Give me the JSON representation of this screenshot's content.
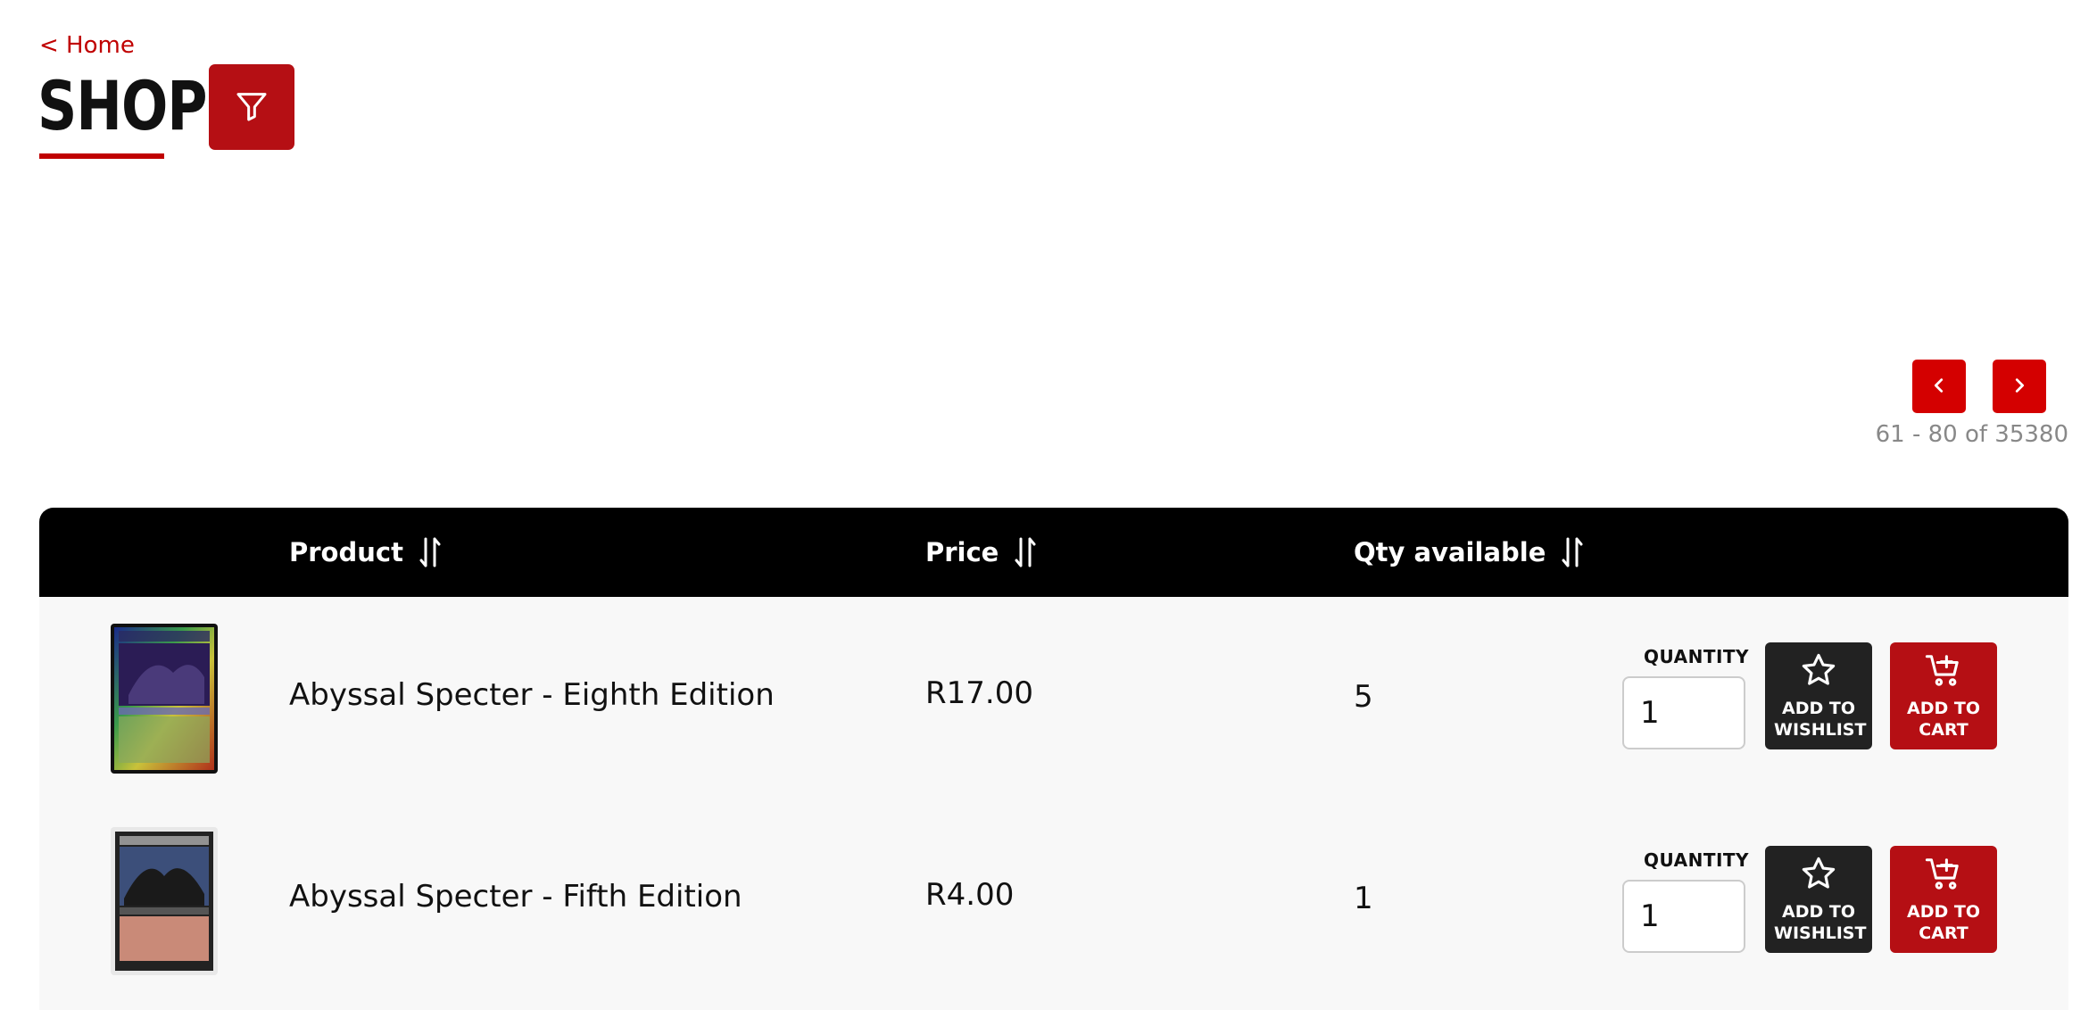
{
  "nav": {
    "home_label": "< Home"
  },
  "page": {
    "title": "SHOP"
  },
  "filter": {
    "icon": "filter-icon"
  },
  "pagination": {
    "range_text": "61 - 80 of 35380",
    "prev_icon": "chevron-left-icon",
    "next_icon": "chevron-right-icon"
  },
  "table": {
    "columns": [
      {
        "label": "Product"
      },
      {
        "label": "Price"
      },
      {
        "label": "Qty available"
      }
    ],
    "rows": [
      {
        "product": "Abyssal Specter - Eighth Edition",
        "price": "R17.00",
        "qty_available": "5",
        "quantity_label": "QUANTITY",
        "quantity_value": "1",
        "wishlist_label": "ADD TO WISHLIST",
        "cart_label": "ADD TO CART"
      },
      {
        "product": "Abyssal Specter - Fifth Edition",
        "price": "R4.00",
        "qty_available": "1",
        "quantity_label": "QUANTITY",
        "quantity_value": "1",
        "wishlist_label": "ADD TO WISHLIST",
        "cart_label": "ADD TO CART"
      }
    ]
  },
  "colors": {
    "accent": "#c00000",
    "button_dark": "#222222",
    "header_bg": "#000000"
  }
}
